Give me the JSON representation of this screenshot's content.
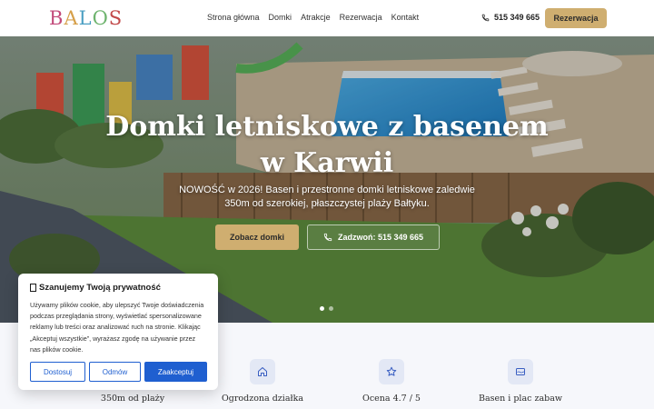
{
  "header": {
    "logo": [
      "B",
      "A",
      "L",
      "O",
      "S"
    ],
    "nav": [
      "Strona główna",
      "Domki",
      "Atrakcje",
      "Rezerwacja",
      "Kontakt"
    ],
    "phone": "515 349 665",
    "reserve_label": "Rezerwacja"
  },
  "hero": {
    "title": "Domki letniskowe z basenem w Karwii",
    "subtitle": "NOWOŚĆ w 2026! Basen i przestronne domki letniskowe zaledwie 350m od szerokiej, płaszczystej plaży Bałtyku.",
    "primary_button": "Zobacz domki",
    "secondary_button": "Zadzwoń: 515 349 665",
    "slides_total": 2,
    "slide_active": 1
  },
  "features": [
    {
      "label": "350m od plaży",
      "icon": "beach-icon"
    },
    {
      "label": "Ogrodzona działka",
      "icon": "home-icon"
    },
    {
      "label": "Ocena 4.7 / 5",
      "icon": "star-icon"
    },
    {
      "label": "Basen i plac zabaw",
      "icon": "pool-icon"
    }
  ],
  "cookie": {
    "title": "Szanujemy Twoją prywatność",
    "text": "Używamy plików cookie, aby ulepszyć Twoje doświadczenia podczas przeglądania strony, wyświetlać spersonalizowane reklamy lub treści oraz analizować ruch na stronie. Klikając „Akceptuj wszystkie”, wyrażasz zgodę na używanie przez nas plików cookie.",
    "buttons": [
      "Dostosuj",
      "Odmów",
      "Zaakceptuj"
    ]
  },
  "colors": {
    "accent": "#cfae70",
    "cookie_blue": "#1f5fd0",
    "feature_bg": "#f6f7fb"
  }
}
